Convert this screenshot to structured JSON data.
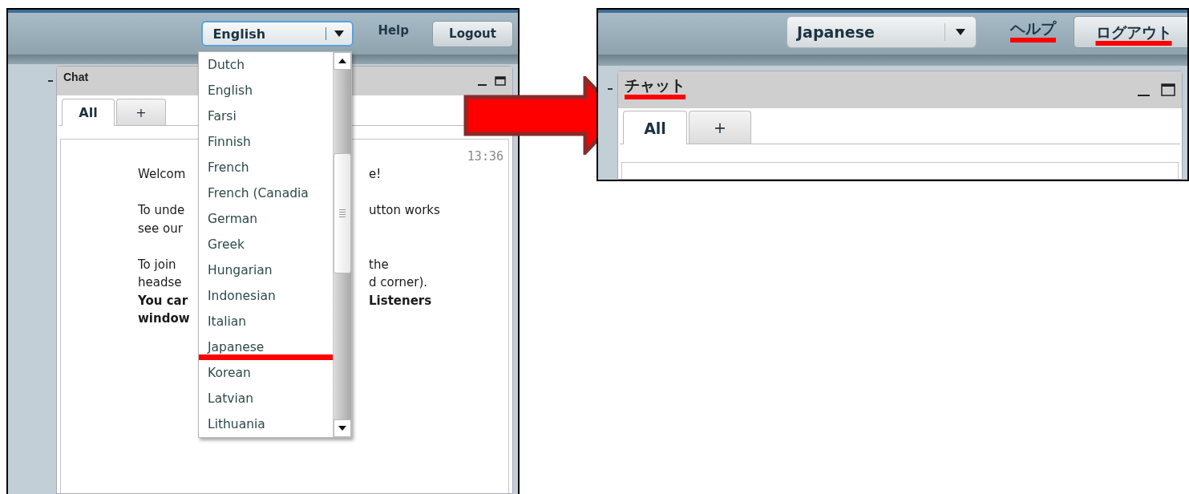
{
  "left_screenshot": {
    "language_select": {
      "value": "English"
    },
    "help_link": {
      "label": "Help",
      "annotated": false
    },
    "logout_button": {
      "label": "Logout",
      "annotated": false
    },
    "chat": {
      "title": "Chat",
      "title_annotated": false,
      "tabs": [
        {
          "label": "All",
          "selected": true
        },
        {
          "label": "+",
          "selected": false
        }
      ],
      "timestamp": "13:36",
      "message_lines": [
        {
          "kind": "text",
          "left": "Welcom",
          "right": "e!",
          "bold": false
        },
        {
          "kind": "gap"
        },
        {
          "kind": "text",
          "left": "To unde",
          "right": "utton works",
          "bold": false
        },
        {
          "kind": "text",
          "left": "see our",
          "bold": false
        },
        {
          "kind": "gap"
        },
        {
          "kind": "text",
          "left": "To join",
          "right": "the",
          "bold": false
        },
        {
          "kind": "text",
          "left": "headse",
          "right": "d corner).",
          "bold": false
        },
        {
          "kind": "text",
          "left": "You car",
          "right": "Listeners",
          "bold": true
        },
        {
          "kind": "text",
          "left": "window",
          "bold": true
        }
      ]
    },
    "language_menu": {
      "options": [
        {
          "label": "Dutch",
          "annotated": false
        },
        {
          "label": "English",
          "annotated": false
        },
        {
          "label": "Farsi",
          "annotated": false
        },
        {
          "label": "Finnish",
          "annotated": false
        },
        {
          "label": "French",
          "annotated": false
        },
        {
          "label": "French (Canadia",
          "annotated": false
        },
        {
          "label": "German",
          "annotated": false
        },
        {
          "label": "Greek",
          "annotated": false
        },
        {
          "label": "Hungarian",
          "annotated": false
        },
        {
          "label": "Indonesian",
          "annotated": false
        },
        {
          "label": "Italian",
          "annotated": false
        },
        {
          "label": "Japanese",
          "annotated": true
        },
        {
          "label": "Korean",
          "annotated": false
        },
        {
          "label": "Latvian",
          "annotated": false
        },
        {
          "label": "Lithuania",
          "annotated": false
        }
      ]
    }
  },
  "right_screenshot": {
    "language_select": {
      "value": "Japanese"
    },
    "help_link": {
      "label": "ヘルプ",
      "annotated": true
    },
    "logout_button": {
      "label": "ログアウト",
      "annotated": true
    },
    "chat": {
      "title": "チャット",
      "title_annotated": true,
      "tabs": [
        {
          "label": "All",
          "selected": true
        },
        {
          "label": "+",
          "selected": false
        }
      ]
    }
  }
}
